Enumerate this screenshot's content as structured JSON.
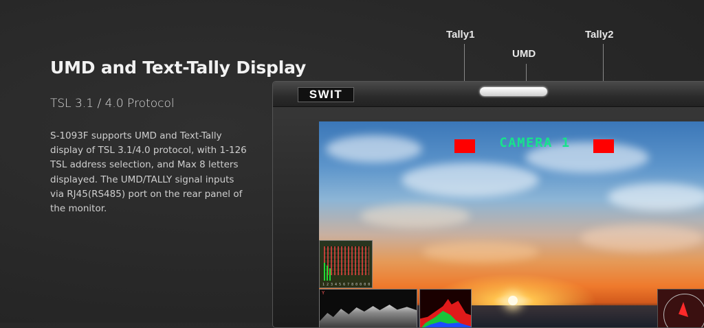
{
  "headline": "UMD and Text-Tally Display",
  "subhead": "TSL 3.1 / 4.0 Protocol",
  "body": "S-1093F supports UMD and Text-Tally display of TSL 3.1/4.0 protocol, with 1-126 TSL address selection, and Max 8 letters displayed. The UMD/TALLY signal inputs via RJ45(RS485) port on the rear panel of the monitor.",
  "callouts": {
    "tally1": "Tally1",
    "umd": "UMD",
    "tally2": "Tally2"
  },
  "monitor": {
    "logo": "SWIT",
    "umd_text": "CAMERA 1",
    "waveform_label": "Y",
    "meter_numbers": "1 2 3 4 5 6 7 8 0 0 0 0",
    "tally_color": "#ff0000",
    "umd_color": "#17e28c"
  }
}
